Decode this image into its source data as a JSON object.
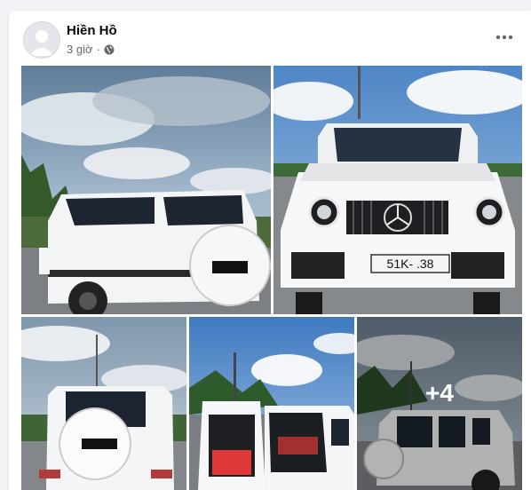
{
  "post": {
    "author": "Hiền Hồ",
    "time": "3 giờ",
    "privacy_icon": "globe-icon",
    "more_icon": "more-horizontal-icon"
  },
  "photos": [
    {
      "subject": "white-g-class-rear-three-quarter"
    },
    {
      "subject": "white-g-class-front",
      "plate": "51K-  .38"
    },
    {
      "subject": "white-g-class-rear"
    },
    {
      "subject": "white-g-class-open-tailgate"
    },
    {
      "subject": "white-g-class-side",
      "more_count": "+4"
    }
  ]
}
